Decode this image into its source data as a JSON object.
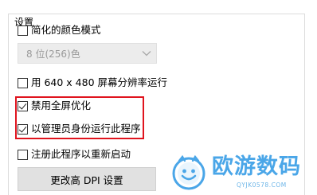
{
  "group": {
    "title": "设置"
  },
  "options": {
    "reduced_color": {
      "label": "简化的颜色模式",
      "checked": false
    },
    "color_dropdown": {
      "value": "8 位(256)色"
    },
    "low_res": {
      "label": "用 640 x 480 屏幕分辨率运行",
      "checked": false
    },
    "disable_fullscreen_opt": {
      "label": "禁用全屏优化",
      "checked": true
    },
    "run_as_admin": {
      "label": "以管理员身份运行此程序",
      "checked": true
    },
    "register_restart": {
      "label": "注册此程序以重新启动",
      "checked": false
    }
  },
  "buttons": {
    "dpi": "更改高 DPI 设置"
  },
  "watermark": {
    "title": "欧游数码",
    "subtitle": "QYJK0578.COM"
  },
  "colors": {
    "highlight": "#e0141e",
    "watermark": "#4aa6e8"
  }
}
